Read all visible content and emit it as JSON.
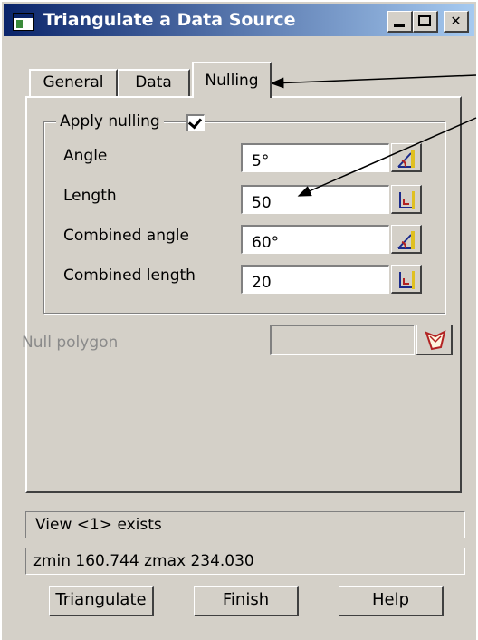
{
  "window": {
    "title": "Triangulate a Data Source",
    "title_icon": "app-icon",
    "controls": {
      "minimize": "minimize-icon",
      "maximize": "maximize-icon",
      "close": "✕"
    }
  },
  "tabs": [
    {
      "label": "General",
      "active": false
    },
    {
      "label": "Data",
      "active": false
    },
    {
      "label": "Nulling",
      "active": true
    }
  ],
  "nulling": {
    "apply_label": "Apply nulling",
    "apply_checked": true,
    "rows": [
      {
        "label": "Angle",
        "value": "5°",
        "picker_icon": "angle-pick-icon"
      },
      {
        "label": "Length",
        "value": "50",
        "picker_icon": "length-pick-icon"
      },
      {
        "label": "Combined angle",
        "value": "60°",
        "picker_icon": "angle-pick-icon"
      },
      {
        "label": "Combined length",
        "value": "20",
        "picker_icon": "length-pick-icon"
      }
    ],
    "null_polygon": {
      "label": "Null polygon",
      "value": "",
      "icon": "polygon-pick-icon",
      "enabled": false
    }
  },
  "status": {
    "line1": "View <1> exists",
    "line2": "zmin 160.744 zmax 234.030"
  },
  "buttons": {
    "triangulate": "Triangulate",
    "finish": "Finish",
    "help": "Help"
  },
  "colors": {
    "titlebar_start": "#0a246a",
    "titlebar_end": "#a6caf0",
    "face": "#d4d0c8",
    "disabled_text": "#8a8a8a"
  }
}
